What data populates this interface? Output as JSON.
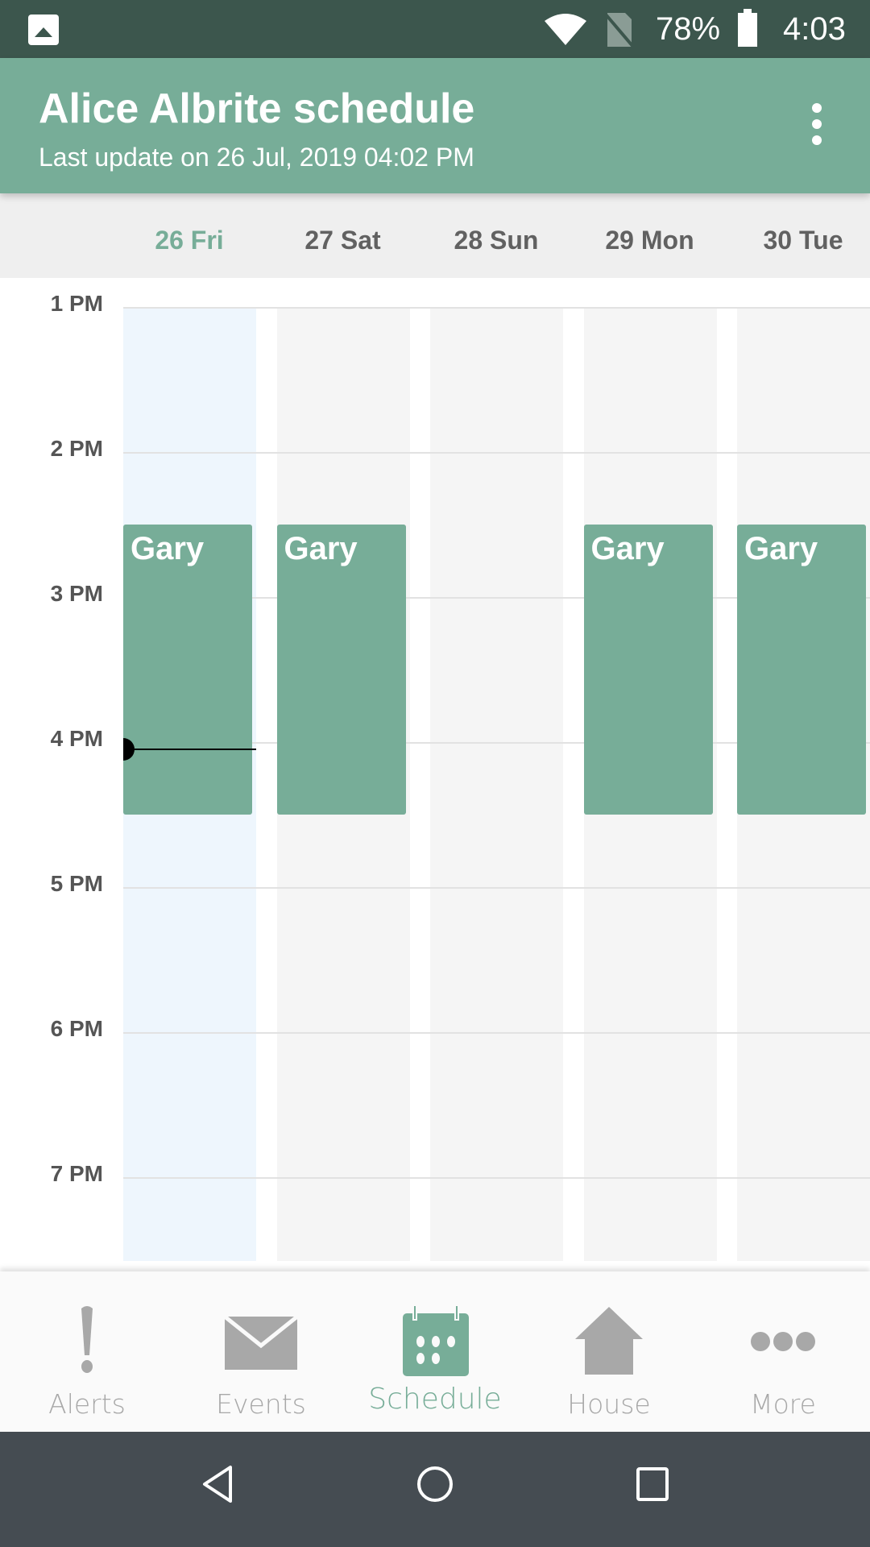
{
  "status_bar": {
    "battery": "78%",
    "time": "4:03",
    "icons": [
      "image-icon",
      "wifi-icon",
      "no-sim-icon",
      "battery-icon"
    ]
  },
  "app_bar": {
    "title": "Alice Albrite schedule",
    "subtitle": "Last update on 26 Jul, 2019 04:02 PM",
    "menu_icon": "more-vert-icon"
  },
  "days": [
    {
      "label": "26 Fri",
      "today": true
    },
    {
      "label": "27 Sat"
    },
    {
      "label": "28 Sun"
    },
    {
      "label": "29 Mon"
    },
    {
      "label": "30 Tue"
    }
  ],
  "hours": [
    "1 PM",
    "2 PM",
    "3 PM",
    "4 PM",
    "5 PM",
    "6 PM",
    "7 PM"
  ],
  "events": [
    {
      "day": 0,
      "title": "Gary",
      "start": "2:30 PM",
      "end": "4:30 PM"
    },
    {
      "day": 1,
      "title": "Gary",
      "start": "2:30 PM",
      "end": "4:30 PM"
    },
    {
      "day": 3,
      "title": "Gary",
      "start": "2:30 PM",
      "end": "4:30 PM"
    },
    {
      "day": 4,
      "title": "Gary",
      "start": "2:30 PM",
      "end": "4:30 PM"
    }
  ],
  "current_time": "4:03 PM",
  "colors": {
    "accent": "#77ad98",
    "status_bar": "#3c564d",
    "today_column": "#eef6fd",
    "inactive": "#a8a8a8"
  },
  "bottom_nav": {
    "active": "Schedule",
    "items": [
      {
        "label": "Alerts",
        "icon": "exclamation-icon"
      },
      {
        "label": "Events",
        "icon": "envelope-icon"
      },
      {
        "label": "Schedule",
        "icon": "calendar-icon"
      },
      {
        "label": "House",
        "icon": "house-icon"
      },
      {
        "label": "More",
        "icon": "more-horiz-icon"
      }
    ]
  },
  "system_nav": [
    "back-icon",
    "home-icon",
    "recents-icon"
  ]
}
